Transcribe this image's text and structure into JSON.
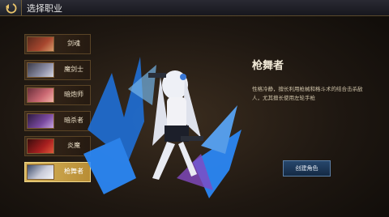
{
  "header": {
    "title": "选择职业"
  },
  "classes": [
    {
      "label": "剑魂",
      "color": "#a8472f"
    },
    {
      "label": "魔剑士",
      "color": "#8d8fa6"
    },
    {
      "label": "暗炮师",
      "color": "#cc6a74"
    },
    {
      "label": "暗杀者",
      "color": "#7a4aa0"
    },
    {
      "label": "炎魔",
      "color": "#a81f1f"
    },
    {
      "label": "枪舞者",
      "color": "#c9cbd8"
    }
  ],
  "selected": {
    "name": "枪舞者",
    "description": "性格冷静，擅长利用枪械和格斗术的结合击杀敌人，尤其擅长使用左轮手枪"
  },
  "create_button": "创建角色",
  "colors": {
    "accent_gold": "#d8b55c",
    "button_blue": "#27476c"
  }
}
